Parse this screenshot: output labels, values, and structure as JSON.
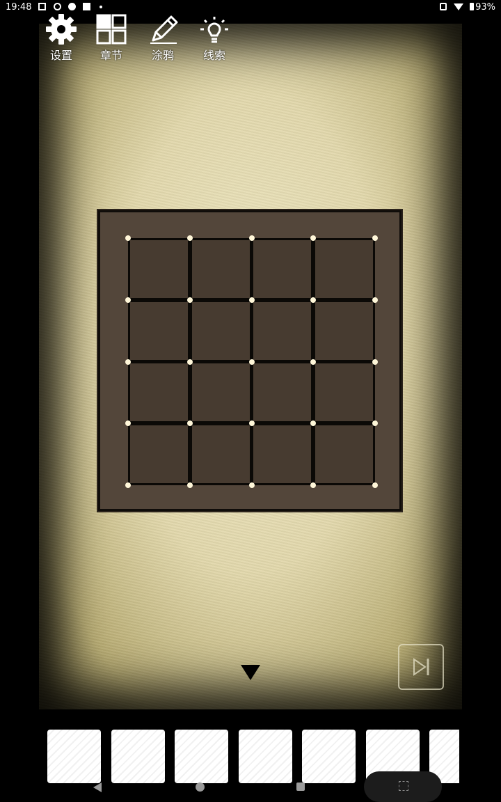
{
  "status": {
    "time": "19:48",
    "battery": "93%"
  },
  "toolbar": {
    "settings_label": "设置",
    "chapters_label": "章节",
    "graffiti_label": "涂鸦",
    "hint_label": "线索"
  },
  "puzzle": {
    "rows": 4,
    "cols": 4
  },
  "inventory": {
    "slot_count": 7
  },
  "icons": {
    "settings": "gear-icon",
    "chapters": "grid-icon",
    "graffiti": "pencil-icon",
    "hint": "lightbulb-icon",
    "skip": "skip-forward-icon",
    "down": "down-arrow-icon"
  },
  "colors": {
    "box": "#53463a",
    "cell": "#473b30",
    "dot": "#fff7d9"
  }
}
